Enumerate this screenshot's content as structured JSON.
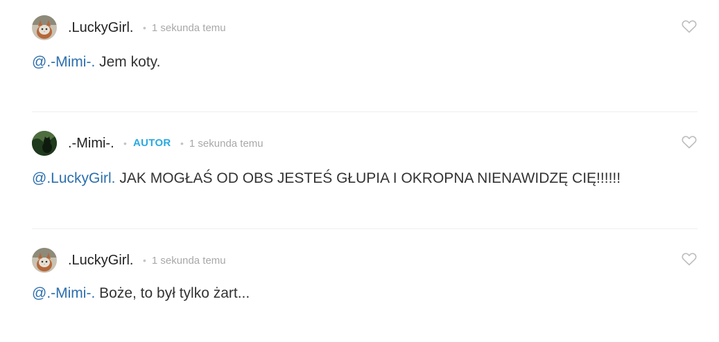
{
  "comments": [
    {
      "username": ".LuckyGirl.",
      "badge": "",
      "timestamp": "1 sekunda temu",
      "mention": "@.-Mimi-.",
      "text": " Jem koty.",
      "avatar": "cat-avatar",
      "like_icon": "heart-outline-icon"
    },
    {
      "username": ".-Mimi-.",
      "badge": "AUTOR",
      "timestamp": "1 sekunda temu",
      "mention": "@.LuckyGirl.",
      "text": " JAK MOGŁAŚ OD OBS JESTEŚ GŁUPIA I OKROPNA NIENAWIDZĘ CIĘ!!!!!!",
      "avatar": "forest-avatar",
      "like_icon": "heart-outline-icon"
    },
    {
      "username": ".LuckyGirl.",
      "badge": "",
      "timestamp": "1 sekunda temu",
      "mention": "@.-Mimi-.",
      "text": " Boże, to był tylko żart...",
      "avatar": "cat-avatar",
      "like_icon": "heart-outline-icon"
    }
  ],
  "colors": {
    "mention": "#2c6fad",
    "badge": "#29a9e2",
    "meta": "#a8a8a8",
    "text": "#333333"
  }
}
